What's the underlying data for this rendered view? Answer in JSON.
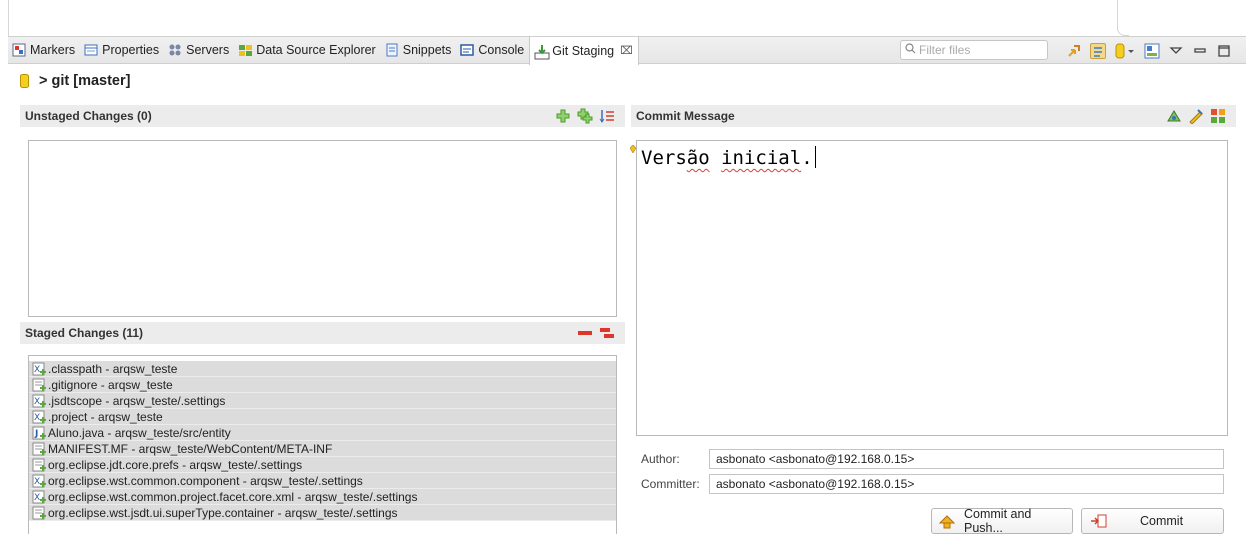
{
  "tabs": [
    {
      "label": "Markers",
      "icon": "markers-icon"
    },
    {
      "label": "Properties",
      "icon": "properties-icon"
    },
    {
      "label": "Servers",
      "icon": "servers-icon"
    },
    {
      "label": "Data Source Explorer",
      "icon": "data-source-icon"
    },
    {
      "label": "Snippets",
      "icon": "snippets-icon"
    },
    {
      "label": "Console",
      "icon": "console-icon"
    },
    {
      "label": "Git Staging",
      "icon": "git-staging-icon",
      "active": true,
      "close": "⌧"
    }
  ],
  "toolbar": {
    "filter_placeholder": "Filter files",
    "icons": [
      "push-icon",
      "compare-icon",
      "repository-dropdown-icon",
      "layout-icon",
      "view-menu-icon",
      "minimize-icon",
      "maximize-icon"
    ]
  },
  "repository": {
    "label": "> git [master]"
  },
  "unstaged": {
    "title": "Unstaged Changes (0)",
    "items": []
  },
  "staged": {
    "title": "Staged Changes (11)",
    "items": [
      {
        "label": ".classpath - arqsw_teste",
        "icon": "xml-file-icon"
      },
      {
        "label": ".gitignore - arqsw_teste",
        "icon": "text-file-icon"
      },
      {
        "label": ".jsdtscope - arqsw_teste/.settings",
        "icon": "xml-file-icon"
      },
      {
        "label": ".project - arqsw_teste",
        "icon": "xml-file-icon"
      },
      {
        "label": "Aluno.java - arqsw_teste/src/entity",
        "icon": "java-file-icon"
      },
      {
        "label": "MANIFEST.MF - arqsw_teste/WebContent/META-INF",
        "icon": "text-file-icon"
      },
      {
        "label": "org.eclipse.jdt.core.prefs - arqsw_teste/.settings",
        "icon": "text-file-icon"
      },
      {
        "label": "org.eclipse.wst.common.component - arqsw_teste/.settings",
        "icon": "xml-file-icon"
      },
      {
        "label": "org.eclipse.wst.common.project.facet.core.xml - arqsw_teste/.settings",
        "icon": "xml-file-icon"
      },
      {
        "label": "org.eclipse.wst.jsdt.ui.superType.container - arqsw_teste/.settings",
        "icon": "text-file-icon"
      }
    ]
  },
  "commit": {
    "title": "Commit Message",
    "message_prefix": "Vers",
    "message_squiggle": "ão",
    "message_space": " ",
    "message_word": "inicial",
    "message_suffix": ".",
    "author_label": "Author:",
    "author_value": "asbonato <asbonato@192.168.0.15>",
    "committer_label": "Committer:",
    "committer_value": "asbonato <asbonato@192.168.0.15>",
    "commit_and_push_label": "Commit and Push...",
    "commit_label": "Commit"
  },
  "colors": {
    "section_header": "#ececec",
    "staged_row": "#dcdcdc",
    "repo_icon": "#f5cf1f",
    "add_icon": "#6cbf3c",
    "remove_icon": "#e0352b"
  }
}
